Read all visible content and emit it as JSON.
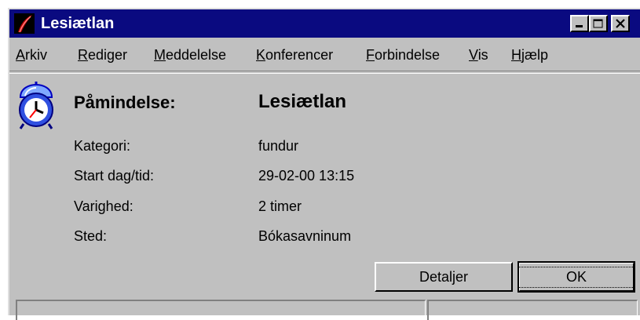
{
  "window": {
    "title": "Lesiætlan",
    "app_icon": "quill-pen-icon",
    "accent": "#0a0a80"
  },
  "title_buttons": [
    "minimize",
    "maximize",
    "close"
  ],
  "menu": [
    {
      "label": "Arkiv",
      "u": "A",
      "rest": "rkiv"
    },
    {
      "label": "Rediger",
      "u": "R",
      "rest": "ediger"
    },
    {
      "label": "Meddelelse",
      "u": "M",
      "rest": "eddelelse"
    },
    {
      "label": "Konferencer",
      "u": "K",
      "rest": "onferencer"
    },
    {
      "label": "Forbindelse",
      "u": "F",
      "rest": "orbindelse"
    },
    {
      "label": "Vis",
      "u": "V",
      "rest": "is"
    },
    {
      "label": "Hjælp",
      "u": "H",
      "rest": "jælp"
    }
  ],
  "reminder": {
    "icon": "alarm-clock-icon",
    "heading_label": "Påmindelse:",
    "heading_value": "Lesiætlan",
    "fields": [
      {
        "label": "Kategori:",
        "value": "fundur"
      },
      {
        "label": "Start dag/tid:",
        "value": "29-02-00 13:15"
      },
      {
        "label": "Varighed:",
        "value": "2 timer"
      },
      {
        "label": "Sted:",
        "value": "Bókasavninum"
      }
    ]
  },
  "buttons": {
    "details": "Detaljer",
    "ok": "OK"
  }
}
